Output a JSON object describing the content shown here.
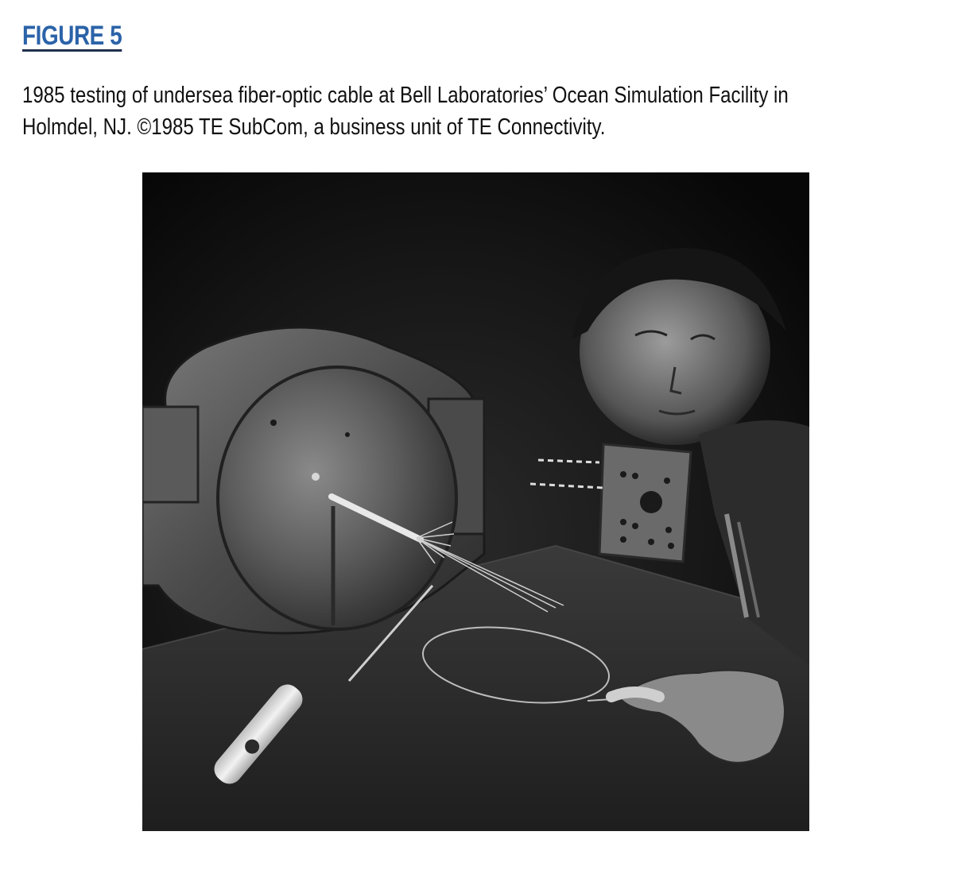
{
  "figure": {
    "label": "FIGURE 5",
    "caption_line1": "1985 testing of undersea fiber-optic cable at Bell Laboratories’ Ocean Simulation Facility in",
    "caption_line2": "Holmdel, NJ. ©1985 TE SubCom, a business unit of TE Connectivity.",
    "label_color": "#2b63a8",
    "photo_icon": "black-and-white-photograph"
  }
}
